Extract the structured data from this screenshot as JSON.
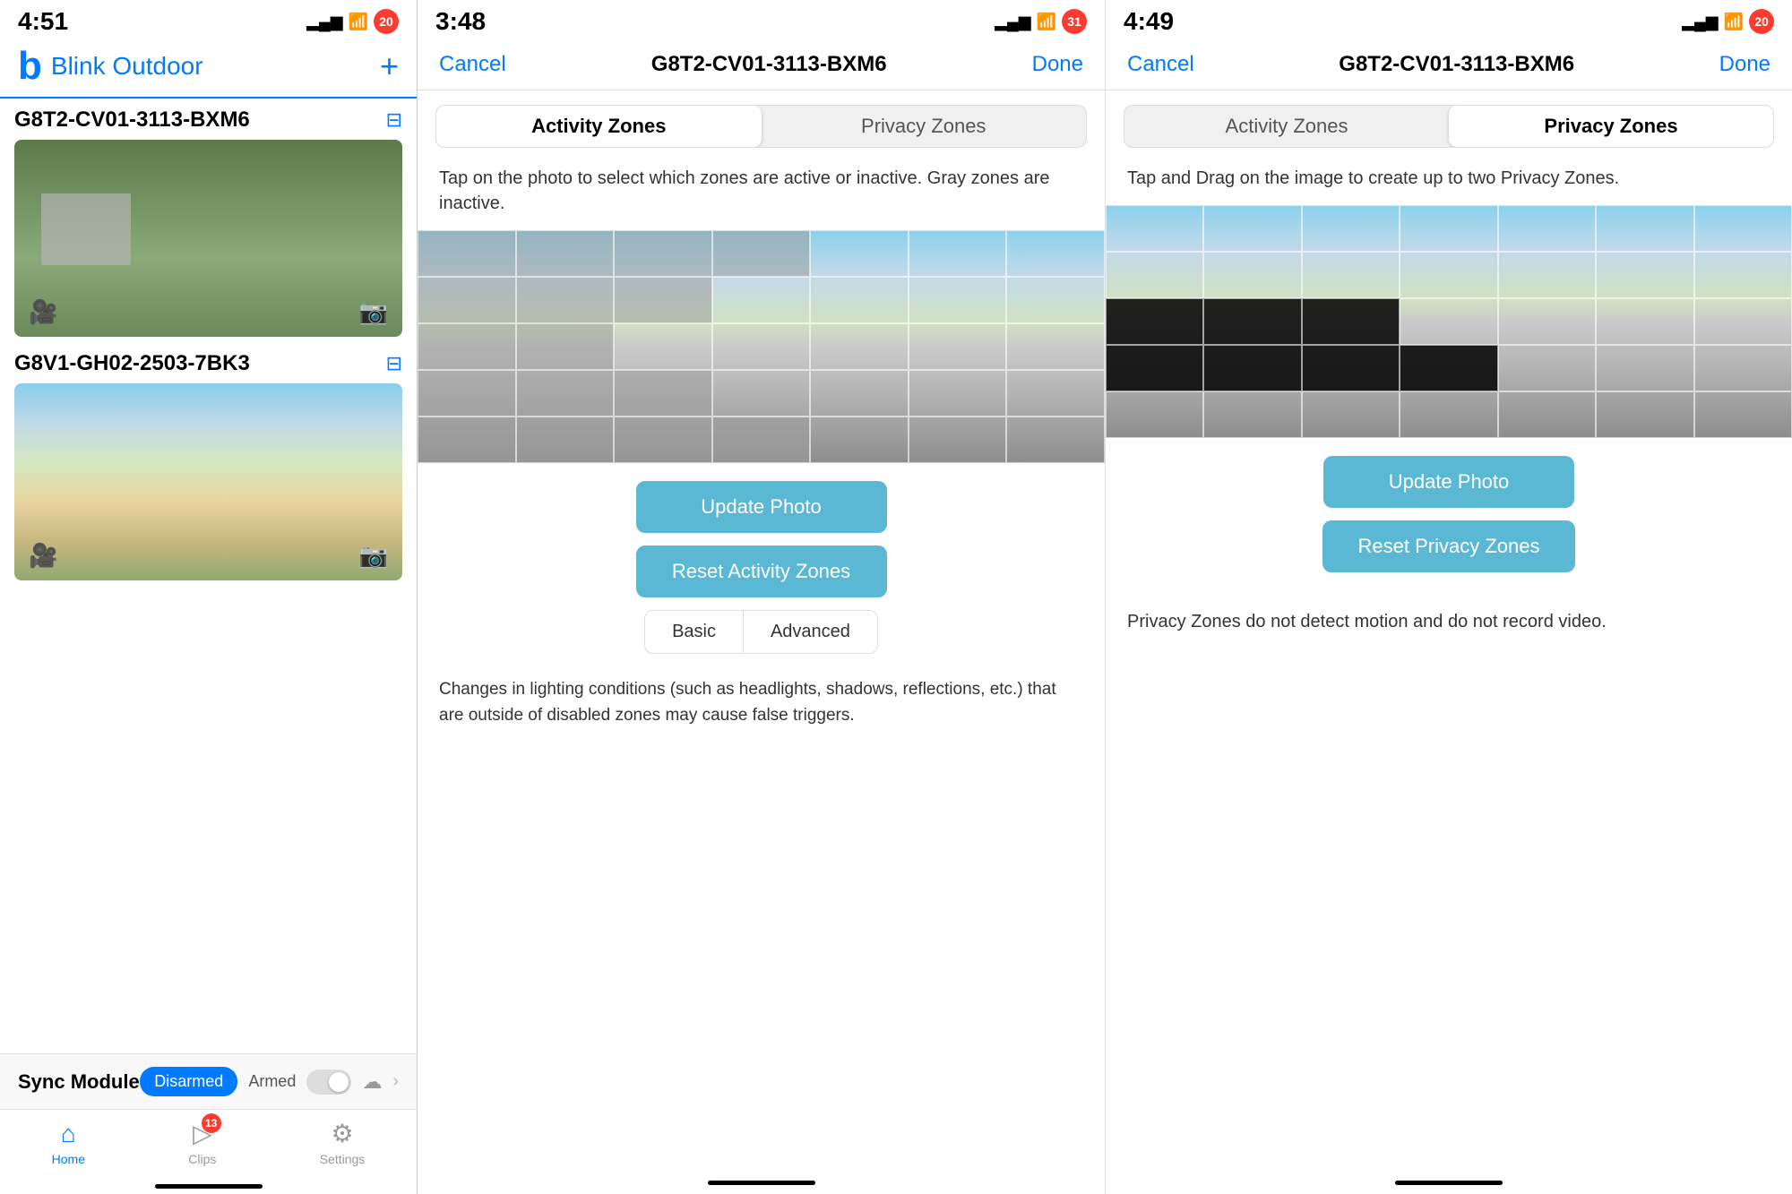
{
  "panel1": {
    "statusBar": {
      "time": "4:51",
      "batteryBadge": "20"
    },
    "header": {
      "logo": "b",
      "appName": "Blink Outdoor",
      "addIcon": "+"
    },
    "camera1": {
      "name": "G8T2-CV01-3113-BXM6",
      "filterIcon": "⊟"
    },
    "camera2": {
      "name": "G8V1-GH02-2503-7BK3",
      "filterIcon": "⊟"
    },
    "syncModule": {
      "label": "Sync Module",
      "disarmed": "Disarmed",
      "armed": "Armed"
    },
    "bottomNav": {
      "homeLabel": "Home",
      "clipsLabel": "Clips",
      "settingsLabel": "Settings",
      "clipsBadge": "13"
    }
  },
  "panel2": {
    "statusBar": {
      "time": "3:48",
      "batteryBadge": "31"
    },
    "navBar": {
      "cancel": "Cancel",
      "cameraId": "G8T2-CV01-3113-BXM6",
      "done": "Done"
    },
    "tabs": {
      "activityZones": "Activity Zones",
      "privacyZones": "Privacy Zones"
    },
    "activeTab": "activityZones",
    "description": "Tap on the photo to select which zones are active or inactive. Gray zones are inactive.",
    "updatePhotoBtn": "Update Photo",
    "resetBtn": "Reset Activity Zones",
    "basicLabel": "Basic",
    "advancedLabel": "Advanced",
    "bottomText": "Changes in lighting conditions (such as headlights, shadows, reflections, etc.) that are outside of disabled zones may cause false triggers."
  },
  "panel3": {
    "statusBar": {
      "time": "4:49",
      "batteryBadge": "20"
    },
    "navBar": {
      "cancel": "Cancel",
      "cameraId": "G8T2-CV01-3113-BXM6",
      "done": "Done"
    },
    "tabs": {
      "activityZones": "Activity Zones",
      "privacyZones": "Privacy Zones"
    },
    "activeTab": "privacyZones",
    "description": "Tap and Drag on the image to create up to two Privacy Zones.",
    "updatePhotoBtn": "Update Photo",
    "resetBtn": "Reset Privacy Zones",
    "privacyInfoText": "Privacy Zones do not detect motion and do not record video."
  }
}
